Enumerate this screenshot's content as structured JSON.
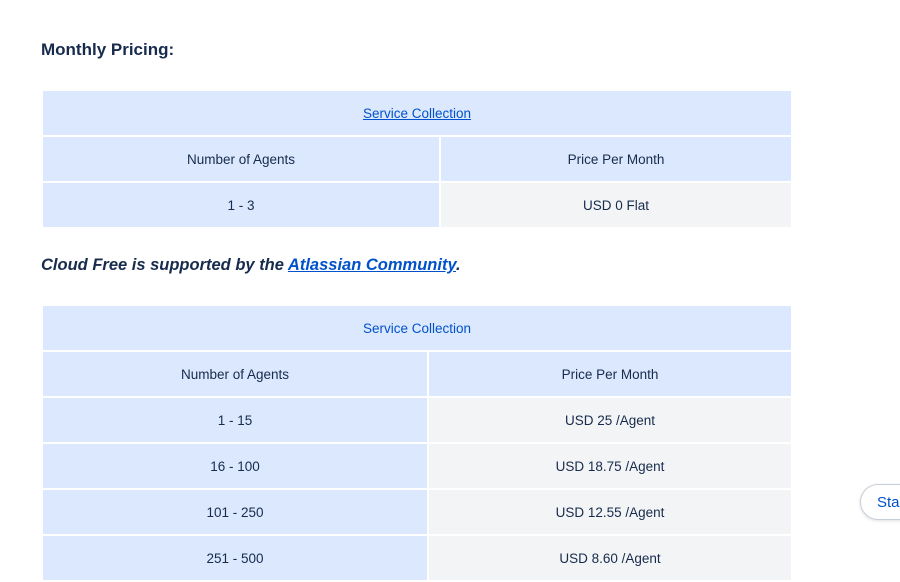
{
  "heading": "Monthly Pricing:",
  "table1": {
    "caption": "Service Collection",
    "headers": [
      "Number of Agents",
      "Price Per Month"
    ],
    "rows": [
      {
        "agents": "1 - 3",
        "price": "USD 0 Flat"
      }
    ]
  },
  "note": {
    "prefix": "Cloud Free is supported by the ",
    "link": "Atlassian Community",
    "suffix": "."
  },
  "table2": {
    "caption": "Service Collection",
    "headers": [
      "Number of Agents",
      "Price Per Month"
    ],
    "rows": [
      {
        "agents": "1 - 15",
        "price": "USD 25 /Agent"
      },
      {
        "agents": "16 - 100",
        "price": "USD 18.75 /Agent"
      },
      {
        "agents": "101 - 250",
        "price": "USD 12.55 /Agent"
      },
      {
        "agents": "251 - 500",
        "price": "USD 8.60 /Agent"
      }
    ]
  },
  "side_button": "Start"
}
